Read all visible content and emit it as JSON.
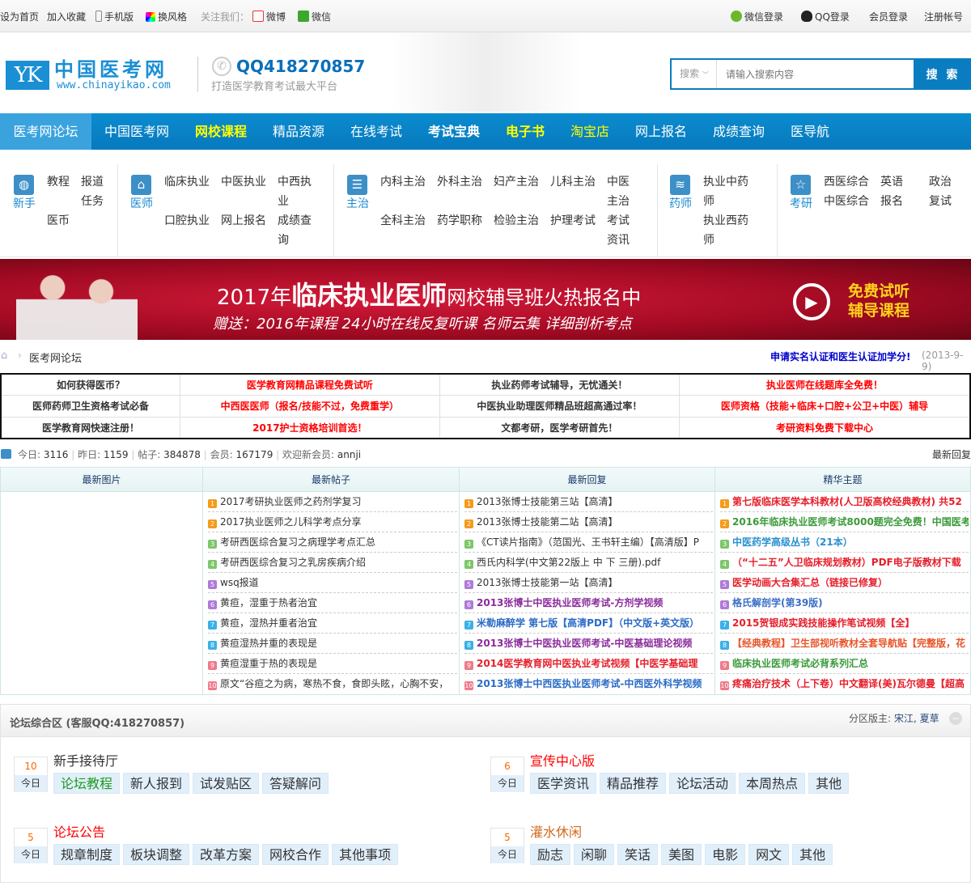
{
  "topbar": {
    "left": [
      "设为首页",
      "加入收藏",
      "手机版",
      "换风格"
    ],
    "follow": "关注我们：",
    "weibo": "微博",
    "weixin": "微信",
    "right": [
      "微信登录",
      "QQ登录",
      "会员登录",
      "注册帐号"
    ]
  },
  "header": {
    "logo_mark": "YK",
    "logo_title": "中国医考网",
    "logo_url": "www.chinayikao.com",
    "qq": "QQ418270857",
    "slogan": "打造医学教育考试最大平台",
    "search_type": "搜索",
    "search_placeholder": "请输入搜索内容",
    "search_button": "搜 索"
  },
  "nav": [
    {
      "label": "医考网论坛",
      "color": "#ffffff"
    },
    {
      "label": "中国医考网",
      "color": "#ffffff"
    },
    {
      "label": "网校课程",
      "color": "#ffff00"
    },
    {
      "label": "精品资源",
      "color": "#ffffff"
    },
    {
      "label": "在线考试",
      "color": "#ffffff"
    },
    {
      "label": "考试宝典",
      "color": "#ffffff"
    },
    {
      "label": "电子书",
      "color": "#ffff00"
    },
    {
      "label": "淘宝店",
      "color": "#ffff00"
    },
    {
      "label": "网上报名",
      "color": "#ffffff"
    },
    {
      "label": "成绩查询",
      "color": "#ffffff"
    },
    {
      "label": "医导航",
      "color": "#ffffff"
    }
  ],
  "categories": [
    {
      "label": "新手",
      "icon": "globe-icon",
      "links": [
        "教程",
        "医币",
        "报道任务"
      ]
    },
    {
      "label": "医师",
      "icon": "home-icon",
      "links": [
        "临床执业",
        "口腔执业",
        "中医执业",
        "网上报名",
        "中西执业",
        "成绩查询"
      ]
    },
    {
      "label": "主治",
      "icon": "list-icon",
      "links": [
        "内科主治",
        "全科主治",
        "外科主治",
        "药学职称",
        "妇产主治",
        "检验主治",
        "儿科主治",
        "护理考试",
        "中医主治",
        "考试资讯"
      ]
    },
    {
      "label": "药师",
      "icon": "layers-icon",
      "links": [
        "执业中药师",
        "执业西药师"
      ]
    },
    {
      "label": "考研",
      "icon": "star-icon",
      "links": [
        "西医综合",
        "中医综合",
        "英语",
        "报名",
        "政治",
        "复试"
      ]
    }
  ],
  "banner": {
    "title_year": "2017年",
    "title_main": "临床执业医师",
    "title_tail": "网校辅导班火热报名中",
    "subtitle": "赠送：2016年课程  24小时在线反复听课  名师云集  详细剖析考点",
    "cta": [
      "免费试听",
      "辅导课程"
    ]
  },
  "breadcrumb": {
    "current": "医考网论坛",
    "notice": "申请实名认证和医生认证加学分!",
    "date": "(2013-9-9)"
  },
  "ads": [
    [
      {
        "text": "如何获得医币？",
        "color": "#333333"
      },
      {
        "text": "医学教育网精品课程免费试听",
        "color": "#ff0000"
      },
      {
        "text": "执业药师考试辅导，无忧通关！",
        "color": "#333333"
      },
      {
        "text": "执业医师在线题库全免费！",
        "color": "#ff0000"
      }
    ],
    [
      {
        "text": "医师药师卫生资格考试必备",
        "color": "#333333"
      },
      {
        "text": "中西医医师（报名/技能不过，免费重学）",
        "color": "#ff0000"
      },
      {
        "text": "中医执业助理医师精品班超高通过率！",
        "color": "#333333"
      },
      {
        "text": "医师资格（技能+临床+口腔+公卫+中医）辅导",
        "color": "#ff0000"
      }
    ],
    [
      {
        "text": "医学教育网快速注册！",
        "color": "#333333"
      },
      {
        "text": "2017护士资格培训首选！",
        "color": "#ff0000"
      },
      {
        "text": "文都考研，医学考研首先！",
        "color": "#333333"
      },
      {
        "text": "考研资料免费下载中心",
        "color": "#ff0000"
      }
    ]
  ],
  "stats": {
    "today_label": "今日:",
    "today": "3116",
    "yesterday_label": "昨日:",
    "yesterday": "1159",
    "posts_label": "帖子:",
    "posts": "384878",
    "members_label": "会员:",
    "members": "167179",
    "welcome_label": "欢迎新会员:",
    "newest": "annji",
    "latest_reply": "最新回复"
  },
  "grid": {
    "headers": [
      "最新图片",
      "最新帖子",
      "最新回复",
      "精华主题"
    ],
    "badge_colors": [
      "#f59b1a",
      "#f59b1a",
      "#7cc66a",
      "#7cc66a",
      "#b07ad8",
      "#b07ad8",
      "#3ab0e8",
      "#3ab0e8",
      "#f07a8a",
      "#f07a8a"
    ],
    "new_posts": [
      {
        "text": "2017考研执业医师之药剂学复习",
        "color": "#333333"
      },
      {
        "text": "2017执业医师之儿科学考点分享",
        "color": "#333333"
      },
      {
        "text": "考研西医综合复习之病理学考点汇总",
        "color": "#333333"
      },
      {
        "text": "考研西医综合复习之乳房疾病介绍",
        "color": "#333333"
      },
      {
        "text": "wsq报道",
        "color": "#333333"
      },
      {
        "text": "黄疸，湿重于热者治宜",
        "color": "#333333"
      },
      {
        "text": "黄疸，湿热并重者治宜",
        "color": "#333333"
      },
      {
        "text": "黄疸湿热并重的表现是",
        "color": "#333333"
      },
      {
        "text": "黄疸湿重于热的表现是",
        "color": "#333333"
      },
      {
        "text": "原文“谷疸之为病，寒热不食，食即头眩，心胸不安，",
        "color": "#333333"
      }
    ],
    "new_replies": [
      {
        "text": "2013张博士技能第三站【高清】",
        "color": "#333333"
      },
      {
        "text": "2013张博士技能第二站【高清】",
        "color": "#333333"
      },
      {
        "text": "《CT读片指南》（范国光、王书轩主编）【高清版】P",
        "color": "#333333"
      },
      {
        "text": "西氏内科学(中文第22版上 中 下 三册).pdf",
        "color": "#333333"
      },
      {
        "text": "2013张博士技能第一站【高清】",
        "color": "#333333"
      },
      {
        "text": "2013张博士中医执业医师考试-方剂学视频",
        "color": "#8b2a9b",
        "bold": true
      },
      {
        "text": "米勒麻醉学 第七版【高清PDF】（中文版+英文版）",
        "color": "#2a6bc6",
        "bold": true
      },
      {
        "text": "2013张博士中医执业医师考试-中医基础理论视频",
        "color": "#8b2a9b",
        "bold": true
      },
      {
        "text": "2014医学教育网中医执业考试视频【中医学基础理",
        "color": "#e61e2a",
        "bold": true
      },
      {
        "text": "2013张博士中西医执业医师考试-中西医外科学视频",
        "color": "#2a6bc6",
        "bold": true
      }
    ],
    "featured": [
      {
        "text": "第七版临床医学本科教材(人卫版高校经典教材) 共52",
        "color": "#e61e2a",
        "bold": true
      },
      {
        "text": "2016年临床执业医师考试8000题完全免费！中国医考",
        "color": "#3a9a3a",
        "bold": true
      },
      {
        "text": "中医药学高级丛书（21本）",
        "color": "#2a8fd0",
        "bold": true
      },
      {
        "text": "（“十二五”人卫临床规划教材）PDF电子版教材下载",
        "color": "#e61e2a",
        "bold": true
      },
      {
        "text": "医学动画大合集汇总（链接已修复）",
        "color": "#e61e2a",
        "bold": true
      },
      {
        "text": "格氏解剖学(第39版)",
        "color": "#3a6fc6",
        "bold": true
      },
      {
        "text": "2015贺银成实践技能操作笔试视频【全】",
        "color": "#e61e2a",
        "bold": true
      },
      {
        "text": "【经典教程】卫生部视听教材全套导航贴【完整版，花",
        "color": "#e8552a",
        "bold": true
      },
      {
        "text": "临床执业医师考试必背系列汇总",
        "color": "#3a9a3a",
        "bold": true
      },
      {
        "text": "疼痛治疗技术（上下卷）中文翻译(美)瓦尔德曼【超高",
        "color": "#e61e2a",
        "bold": true
      }
    ]
  },
  "forum": {
    "title": "论坛综合区 (客服QQ:418270857)",
    "mods_label": "分区版主:",
    "mods": "宋江, 夏草",
    "today": "今日",
    "boards": [
      {
        "name": "新手接待厅",
        "color": "#333333",
        "count": "10",
        "subs": [
          "论坛教程",
          "新人报到",
          "试发贴区",
          "答疑解问"
        ]
      },
      {
        "name": "宣传中心版",
        "color": "#ff0000",
        "count": "6",
        "subs": [
          "医学资讯",
          "精品推荐",
          "论坛活动",
          "本周热点",
          "其他"
        ]
      },
      {
        "name": "论坛公告",
        "color": "#ff0000",
        "count": "5",
        "subs": [
          "规章制度",
          "板块调整",
          "改革方案",
          "网校合作",
          "其他事项"
        ]
      },
      {
        "name": "灌水休闲",
        "color": "#d2691e",
        "count": "5",
        "subs": [
          "励志",
          "闲聊",
          "笑话",
          "美图",
          "电影",
          "网文",
          "其他"
        ]
      }
    ]
  }
}
